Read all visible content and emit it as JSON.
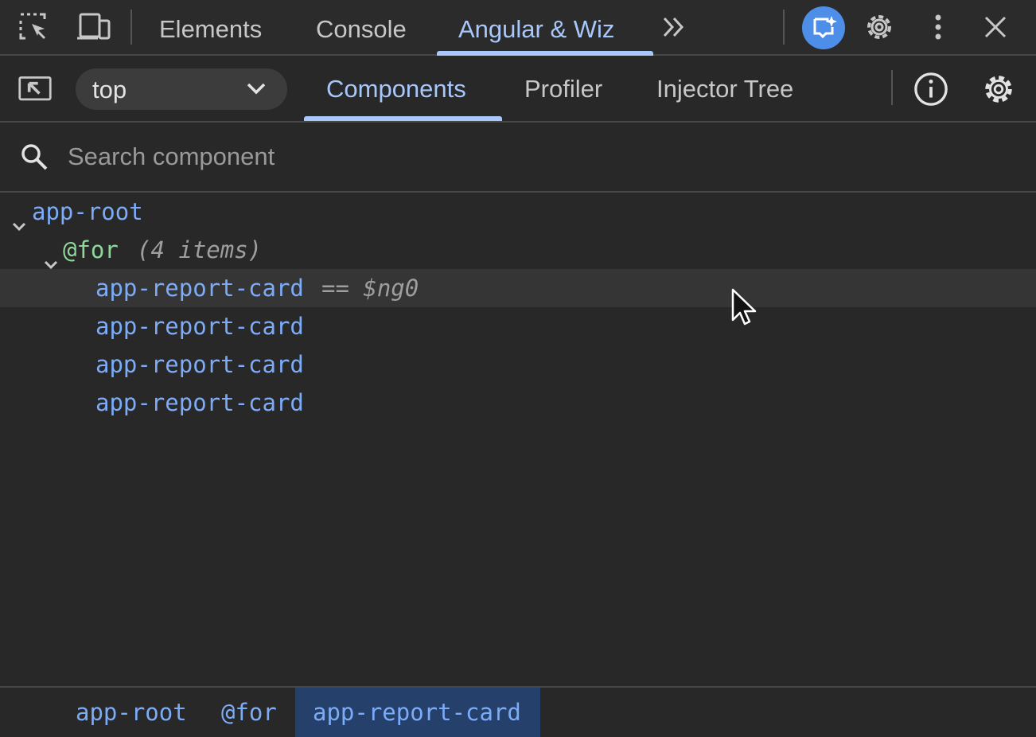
{
  "toolbar": {
    "tabs": [
      {
        "label": "Elements"
      },
      {
        "label": "Console"
      },
      {
        "label": "Angular & Wiz"
      }
    ],
    "active_tab": "Angular & Wiz",
    "icons": [
      "inspect-element-icon",
      "device-toolbar-icon",
      "more-tabs-icon",
      "ai-assistance-icon",
      "settings-icon",
      "more-options-icon",
      "close-icon"
    ]
  },
  "angular_toolbar": {
    "frame_select": {
      "value": "top"
    },
    "tabs": [
      {
        "label": "Components"
      },
      {
        "label": "Profiler"
      },
      {
        "label": "Injector Tree"
      }
    ],
    "active_tab": "Components"
  },
  "search": {
    "placeholder": "Search component",
    "value": ""
  },
  "tree": {
    "root": {
      "label": "app-root"
    },
    "for_block": {
      "label": "@for",
      "meta": "(4 items)"
    },
    "children": [
      {
        "label": "app-report-card",
        "suffix": "== $ng0",
        "selected": true
      },
      {
        "label": "app-report-card"
      },
      {
        "label": "app-report-card"
      },
      {
        "label": "app-report-card"
      }
    ]
  },
  "breadcrumb": [
    {
      "label": "app-root"
    },
    {
      "label": "@for"
    },
    {
      "label": "app-report-card",
      "active": true
    }
  ],
  "colors": {
    "accent": "#a8c7fa",
    "node": "#7cacf8",
    "control_flow": "#8ed99a",
    "background": "#282828"
  }
}
